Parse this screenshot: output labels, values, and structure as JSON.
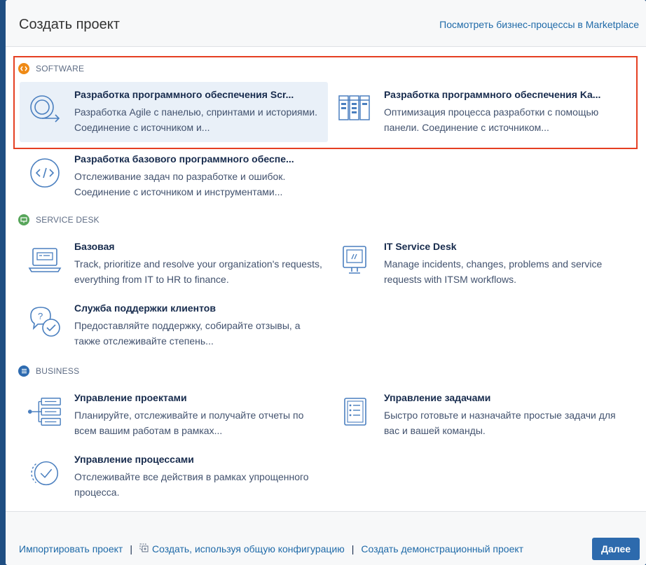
{
  "header": {
    "title": "Создать проект",
    "marketplace_link": "Посмотреть бизнес-процессы в Marketplace"
  },
  "sections": {
    "software": {
      "label": "SOFTWARE",
      "icon": "code-icon",
      "color": "#ef8a16",
      "items": [
        {
          "name": "Разработка программного обеспечения Scr...",
          "desc": "Разработка Agile с панелью, спринтами и историями. Соединение с источником и...",
          "icon": "scrum-cycle-icon",
          "selected": true
        },
        {
          "name": "Разработка программного обеспечения Ka...",
          "desc": "Оптимизация процесса разработки с помощью панели. Соединение с источником...",
          "icon": "kanban-board-icon"
        },
        {
          "name": "Разработка базового программного обеспе...",
          "desc": "Отслеживание задач по разработке и ошибок. Соединение с источником и инструментами...",
          "icon": "code-circle-icon"
        }
      ]
    },
    "service_desk": {
      "label": "SERVICE DESK",
      "icon": "monitor-icon",
      "color": "#57a55a",
      "items": [
        {
          "name": "Базовая",
          "desc": "Track, prioritize and resolve your organization's requests, everything from IT to HR to finance.",
          "icon": "laptop-icon"
        },
        {
          "name": "IT Service Desk",
          "desc": "Manage incidents, changes, problems and service requests with ITSM workflows.",
          "icon": "monitor-icon"
        },
        {
          "name": "Служба поддержки клиентов",
          "desc": "Предоставляйте поддержку, собирайте отзывы, а также отслеживайте степень...",
          "icon": "chat-bubbles-icon"
        }
      ]
    },
    "business": {
      "label": "BUSINESS",
      "icon": "list-icon",
      "color": "#2e6bb0",
      "items": [
        {
          "name": "Управление проектами",
          "desc": "Планируйте, отслеживайте и получайте отчеты по всем вашим работам в рамках...",
          "icon": "project-tree-icon"
        },
        {
          "name": "Управление задачами",
          "desc": "Быстро готовьте и назначайте простые задачи для вас и вашей команды.",
          "icon": "checklist-icon"
        },
        {
          "name": "Управление процессами",
          "desc": "Отслеживайте все действия в рамках упрощенного процесса.",
          "icon": "process-check-icon"
        }
      ]
    }
  },
  "footer": {
    "import_link": "Импортировать проект",
    "shared_config_link": "Создать, используя общую конфигурацию",
    "demo_link": "Создать демонстрационный проект",
    "next_button": "Далее",
    "separator": "|"
  },
  "colors": {
    "accent": "#2d6aad",
    "link": "#1f6aa8",
    "highlight_border": "#e53f22",
    "selected_bg": "#e9f0f8",
    "page_bg": "#1f4e82"
  }
}
